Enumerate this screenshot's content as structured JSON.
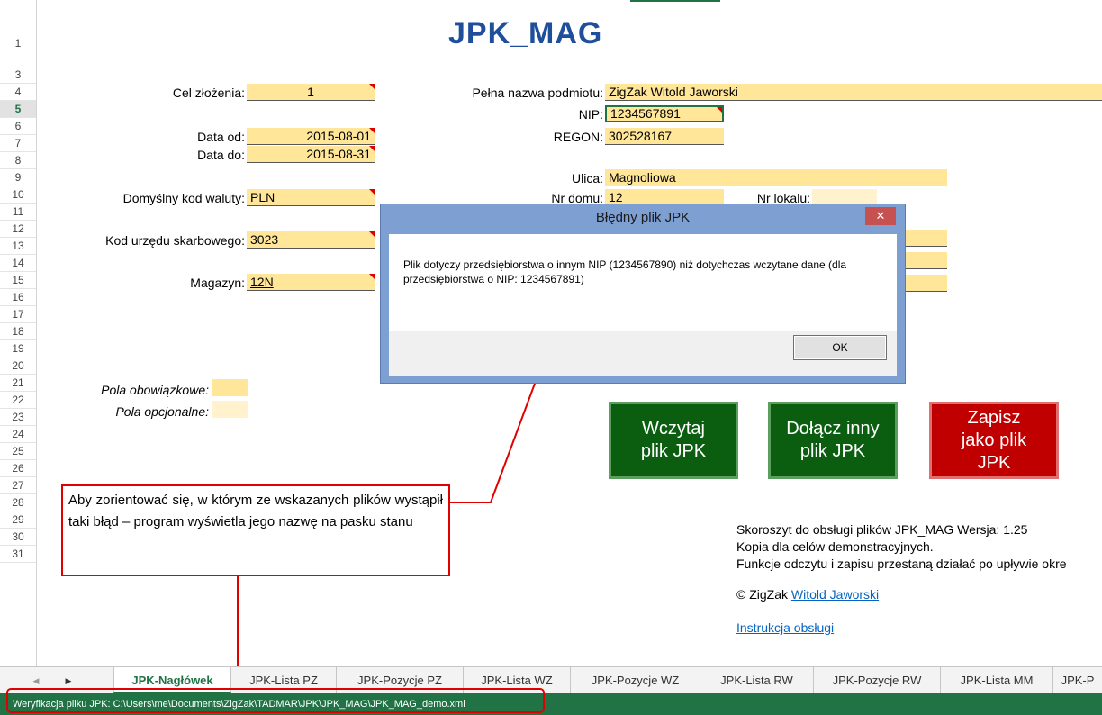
{
  "title": "JPK_MAG",
  "rows": [
    "1",
    "3",
    "4",
    "5",
    "6",
    "7",
    "8",
    "9",
    "10",
    "11",
    "12",
    "13",
    "14",
    "15",
    "16",
    "17",
    "18",
    "19",
    "20",
    "21",
    "22",
    "23",
    "24",
    "25",
    "26",
    "27",
    "28",
    "29",
    "30",
    "31"
  ],
  "form": {
    "cel_label": "Cel złożenia:",
    "cel_value": "1",
    "data_od_label": "Data od:",
    "data_od_value": "2015-08-01",
    "data_do_label": "Data do:",
    "data_do_value": "2015-08-31",
    "waluta_label": "Domyślny kod waluty:",
    "waluta_value": "PLN",
    "urzad_label": "Kod urzędu skarbowego:",
    "urzad_value": "3023",
    "magazyn_label": "Magazyn:",
    "magazyn_value": "12N",
    "nazwa_label": "Pełna nazwa podmiotu:",
    "nazwa_value": "ZigZak Witold Jaworski",
    "nip_label": "NIP:",
    "nip_value": "1234567891",
    "regon_label": "REGON:",
    "regon_value": "302528167",
    "ulica_label": "Ulica:",
    "ulica_value": "Magnoliowa",
    "nrdomu_label": "Nr domu:",
    "nrdomu_value": "12",
    "nrlokalu_label": "Nr lokalu:",
    "obow_label": "Pola obowiązkowe:",
    "opcj_label": "Pola opcjonalne:"
  },
  "buttons": {
    "wczytaj": "Wczytaj plik JPK",
    "dolacz": "Dołącz inny plik JPK",
    "zapisz": "Zapisz jako plik JPK"
  },
  "info": {
    "line1": "Skoroszyt do obsługi plików JPK_MAG    Wersja: 1.25",
    "line2": "Kopia dla celów demonstracyjnych.",
    "line3": "Funkcje odczytu i zapisu przestaną działać po upływie okre",
    "copyright_prefix": "© ZigZak ",
    "copyright_link": "Witold Jaworski",
    "manual": "Instrukcja obsługi"
  },
  "dialog": {
    "title": "Błędny plik JPK",
    "close": "✕",
    "message": "Plik dotyczy przedsiębiorstwa o innym NIP (1234567890) niż dotychczas wczytane dane (dla przedsiębiorstwa o NIP: 1234567891)",
    "ok": "OK"
  },
  "callout": "Aby zorientować się, w którym ze wskazanych plików wystąpił taki błąd – program wyświetla jego nazwę na pasku stanu",
  "tabs": [
    "JPK-Nagłówek",
    "JPK-Lista PZ",
    "JPK-Pozycje PZ",
    "JPK-Lista WZ",
    "JPK-Pozycje WZ",
    "JPK-Lista RW",
    "JPK-Pozycje RW",
    "JPK-Lista MM",
    "JPK-P"
  ],
  "tab_nav": {
    "prev": "◀",
    "next": "▶"
  },
  "status": "Weryfikacja pliku JPK: C:\\Users\\me\\Documents\\ZigZak\\TADMAR\\JPK\\JPK_MAG\\JPK_MAG_demo.xml",
  "colors": {
    "excel_green": "#217346",
    "required": "#ffe699",
    "optional": "#fff2cc",
    "title_blue": "#1f4e9a"
  }
}
